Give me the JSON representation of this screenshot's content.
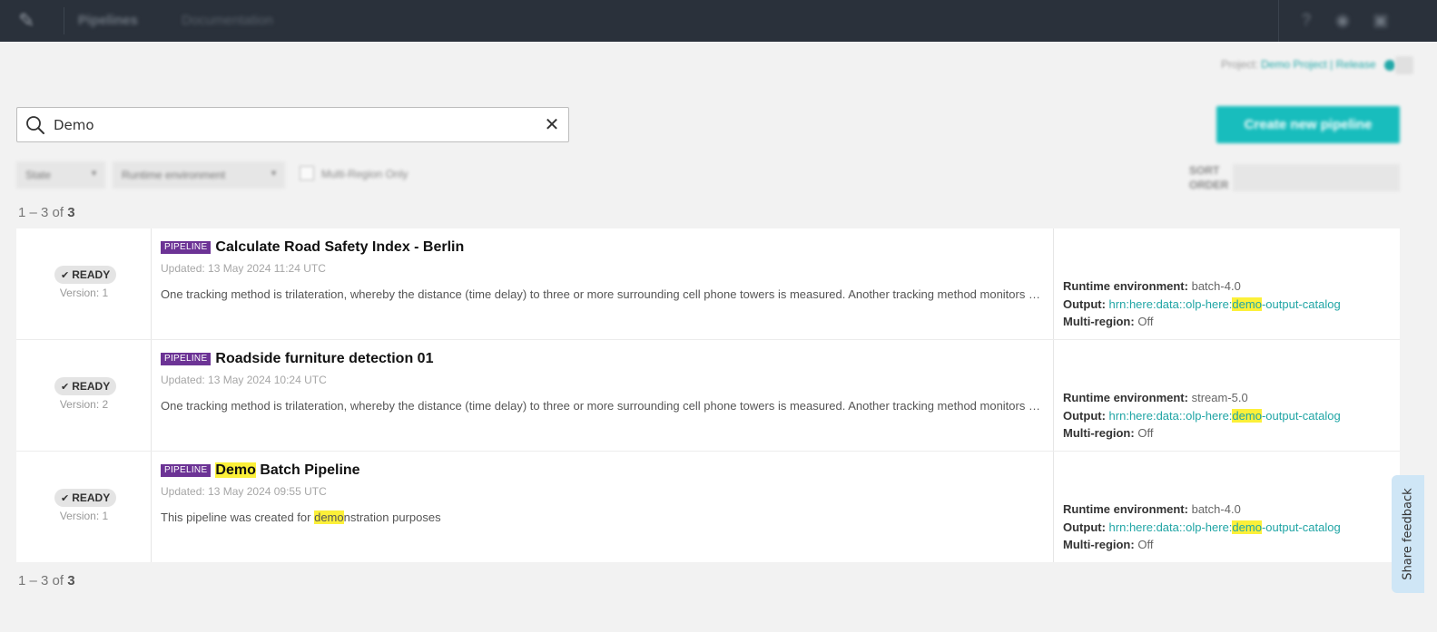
{
  "nav": {
    "brand": "Pipelines",
    "documentation": "Documentation",
    "logo_icon": "pen-icon"
  },
  "project": {
    "label": "Project:",
    "name": "Demo Project | Release"
  },
  "search": {
    "value": "Demo",
    "placeholder": "Search"
  },
  "create_button": "Create new pipeline",
  "filters": {
    "state": "State",
    "runtime": "Runtime environment",
    "multi_region": "Multi-Region Only",
    "sort_label_1": "SORT",
    "sort_label_2": "ORDER"
  },
  "results": {
    "range": "1 – 3 of ",
    "total": "3"
  },
  "pipelines": [
    {
      "status": "READY",
      "version": "Version: 1",
      "tag": "PIPELINE",
      "title_hl": "",
      "title": "Calculate Road Safety Index - Berlin",
      "updated": "Updated: 13 May 2024 11:24 UTC",
      "desc_hl": "",
      "desc": "One tracking method is trilateration, whereby the distance (time delay) to three or more surrounding cell phone towers is measured. Another tracking method monitors the signal strength",
      "runtime_label": "Runtime environment:",
      "runtime": "batch-4.0",
      "output_label": "Output:",
      "output_pre": "hrn:here:data::olp-here:",
      "output_hl": "demo",
      "output_post": "-output-catalog",
      "multi_label": "Multi-region:",
      "multi": "Off"
    },
    {
      "status": "READY",
      "version": "Version: 2",
      "tag": "PIPELINE",
      "title_hl": "",
      "title": "Roadside furniture detection 01",
      "updated": "Updated: 13 May 2024 10:24 UTC",
      "desc_hl": "",
      "desc": "One tracking method is trilateration, whereby the distance (time delay) to three or more surrounding cell phone towers is measured. Another tracking method monitors the signal strength",
      "runtime_label": "Runtime environment:",
      "runtime": "stream-5.0",
      "output_label": "Output:",
      "output_pre": "hrn:here:data::olp-here:",
      "output_hl": "demo",
      "output_post": "-output-catalog",
      "multi_label": "Multi-region:",
      "multi": "Off"
    },
    {
      "status": "READY",
      "version": "Version: 1",
      "tag": "PIPELINE",
      "title_hl": "Demo",
      "title": " Batch Pipeline",
      "updated": "Updated: 13 May 2024 09:55 UTC",
      "desc_pre": "This pipeline was created for ",
      "desc_hl": "demo",
      "desc": "nstration purposes",
      "runtime_label": "Runtime environment:",
      "runtime": "batch-4.0",
      "output_label": "Output:",
      "output_pre": "hrn:here:data::olp-here:",
      "output_hl": "demo",
      "output_post": "-output-catalog",
      "multi_label": "Multi-region:",
      "multi": "Off"
    }
  ],
  "feedback": "Share feedback",
  "colors": {
    "topbar": "#2a313b",
    "accent": "#18bdbd",
    "tag": "#6c3395",
    "highlight": "#fcf039",
    "link": "#20a5a5"
  }
}
